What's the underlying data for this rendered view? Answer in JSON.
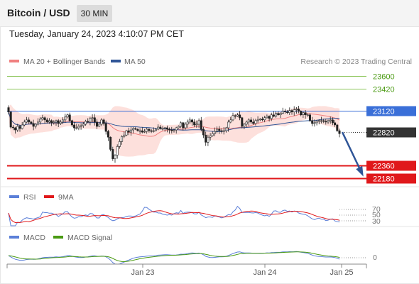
{
  "header": {
    "title": "Bitcoin / USD",
    "timeframe": "30 MIN"
  },
  "timestamp": "Tuesday, January 24, 2023 4:10:07 PM CET",
  "legend": {
    "ma_bb": "MA 20 + Bollinger Bands",
    "ma50": "MA 50",
    "credit": "Research © 2023 Trading Central"
  },
  "colors": {
    "resistance_green": "#8cc65a",
    "pivot_blue": "#3a6fd8",
    "support_red": "#e0181b",
    "current_dark": "#333333",
    "ma20": "#f08080",
    "bollinger_fill": "#fde0dc",
    "ma50": "#2f5597",
    "candle_up": "#222222",
    "candle_down": "#222222",
    "forecast_arrow": "#2f5597",
    "rsi": "#5b7fd8",
    "rsi_9ma": "#e0181b",
    "macd": "#5b7fd8",
    "macd_signal": "#4a9a12"
  },
  "levels": [
    {
      "value": 23600,
      "label": "23600",
      "kind": "resistance"
    },
    {
      "value": 23420,
      "label": "23420",
      "kind": "resistance"
    },
    {
      "value": 23120,
      "label": "23120",
      "kind": "pivot"
    },
    {
      "value": 22820,
      "label": "22820",
      "kind": "current"
    },
    {
      "value": 22360,
      "label": "22360",
      "kind": "support"
    },
    {
      "value": 22180,
      "label": "22180",
      "kind": "support"
    }
  ],
  "rsi_panel": {
    "rsi_label": "RSI",
    "ma_label": "9MA",
    "levels": [
      "70",
      "50",
      "30"
    ]
  },
  "macd_panel": {
    "macd_label": "MACD",
    "signal_label": "MACD Signal",
    "zero_label": "0"
  },
  "x_axis": {
    "dates": [
      "Jan 23",
      "Jan 24",
      "Jan 25"
    ]
  },
  "chart_data": {
    "type": "candlestick",
    "title": "Bitcoin / USD",
    "interval": "30 MIN",
    "ylim": [
      22150,
      23750
    ],
    "close_series": [
      23100,
      22890,
      22880,
      22850,
      22900,
      22870,
      22920,
      22960,
      22990,
      22960,
      22940,
      22900,
      22930,
      22960,
      23000,
      23020,
      22990,
      22960,
      22980,
      22950,
      22960,
      22980,
      22940,
      22960,
      22990,
      23030,
      23060,
      22980,
      22920,
      22880,
      22880,
      22900,
      22910,
      22930,
      22970,
      22960,
      23010,
      23020,
      22960,
      22900,
      22930,
      22990,
      22940,
      22830,
      22750,
      22580,
      22450,
      22500,
      22620,
      22690,
      22760,
      22780,
      22840,
      22820,
      22850,
      22870,
      22860,
      22840,
      22840,
      22820,
      22830,
      22860,
      22840,
      22830,
      22840,
      22860,
      22890,
      22870,
      22870,
      22880,
      22860,
      22850,
      22840,
      22850,
      22880,
      22900,
      22950,
      22880,
      22930,
      22960,
      22990,
      22960,
      22920,
      22930,
      22980,
      22860,
      22780,
      22680,
      22750,
      22770,
      22800,
      22830,
      22860,
      22840,
      22830,
      22840,
      22880,
      22960,
      22990,
      23050,
      23040,
      23060,
      23020,
      22900,
      22930,
      22960,
      22990,
      22960,
      22940,
      22980,
      22990,
      23000,
      22990,
      23020,
      23040,
      23010,
      23060,
      23040,
      23080,
      23060,
      23080,
      23110,
      23100,
      23090,
      23120,
      23100,
      23130,
      23140,
      23110,
      23060,
      23090,
      23060,
      23060,
      22980,
      22940,
      22950,
      22970,
      22980,
      22980,
      22970,
      22960,
      22980,
      22990,
      22950,
      22920,
      22840,
      22800
    ],
    "x_tick_labels": [
      "Jan 23",
      "Jan 24",
      "Jan 25"
    ],
    "series": [
      {
        "name": "MA 20 + Bollinger Bands",
        "role": "ma20_with_bands"
      },
      {
        "name": "MA 50",
        "role": "ma50"
      }
    ],
    "support_resistance": [
      23600,
      23420,
      23120,
      22820,
      22360,
      22180
    ],
    "forecast": {
      "from": 22820,
      "to": 22180,
      "direction": "down"
    },
    "rsi": {
      "levels": [
        70,
        50,
        30
      ]
    },
    "macd": {
      "zero_line": 0
    }
  }
}
